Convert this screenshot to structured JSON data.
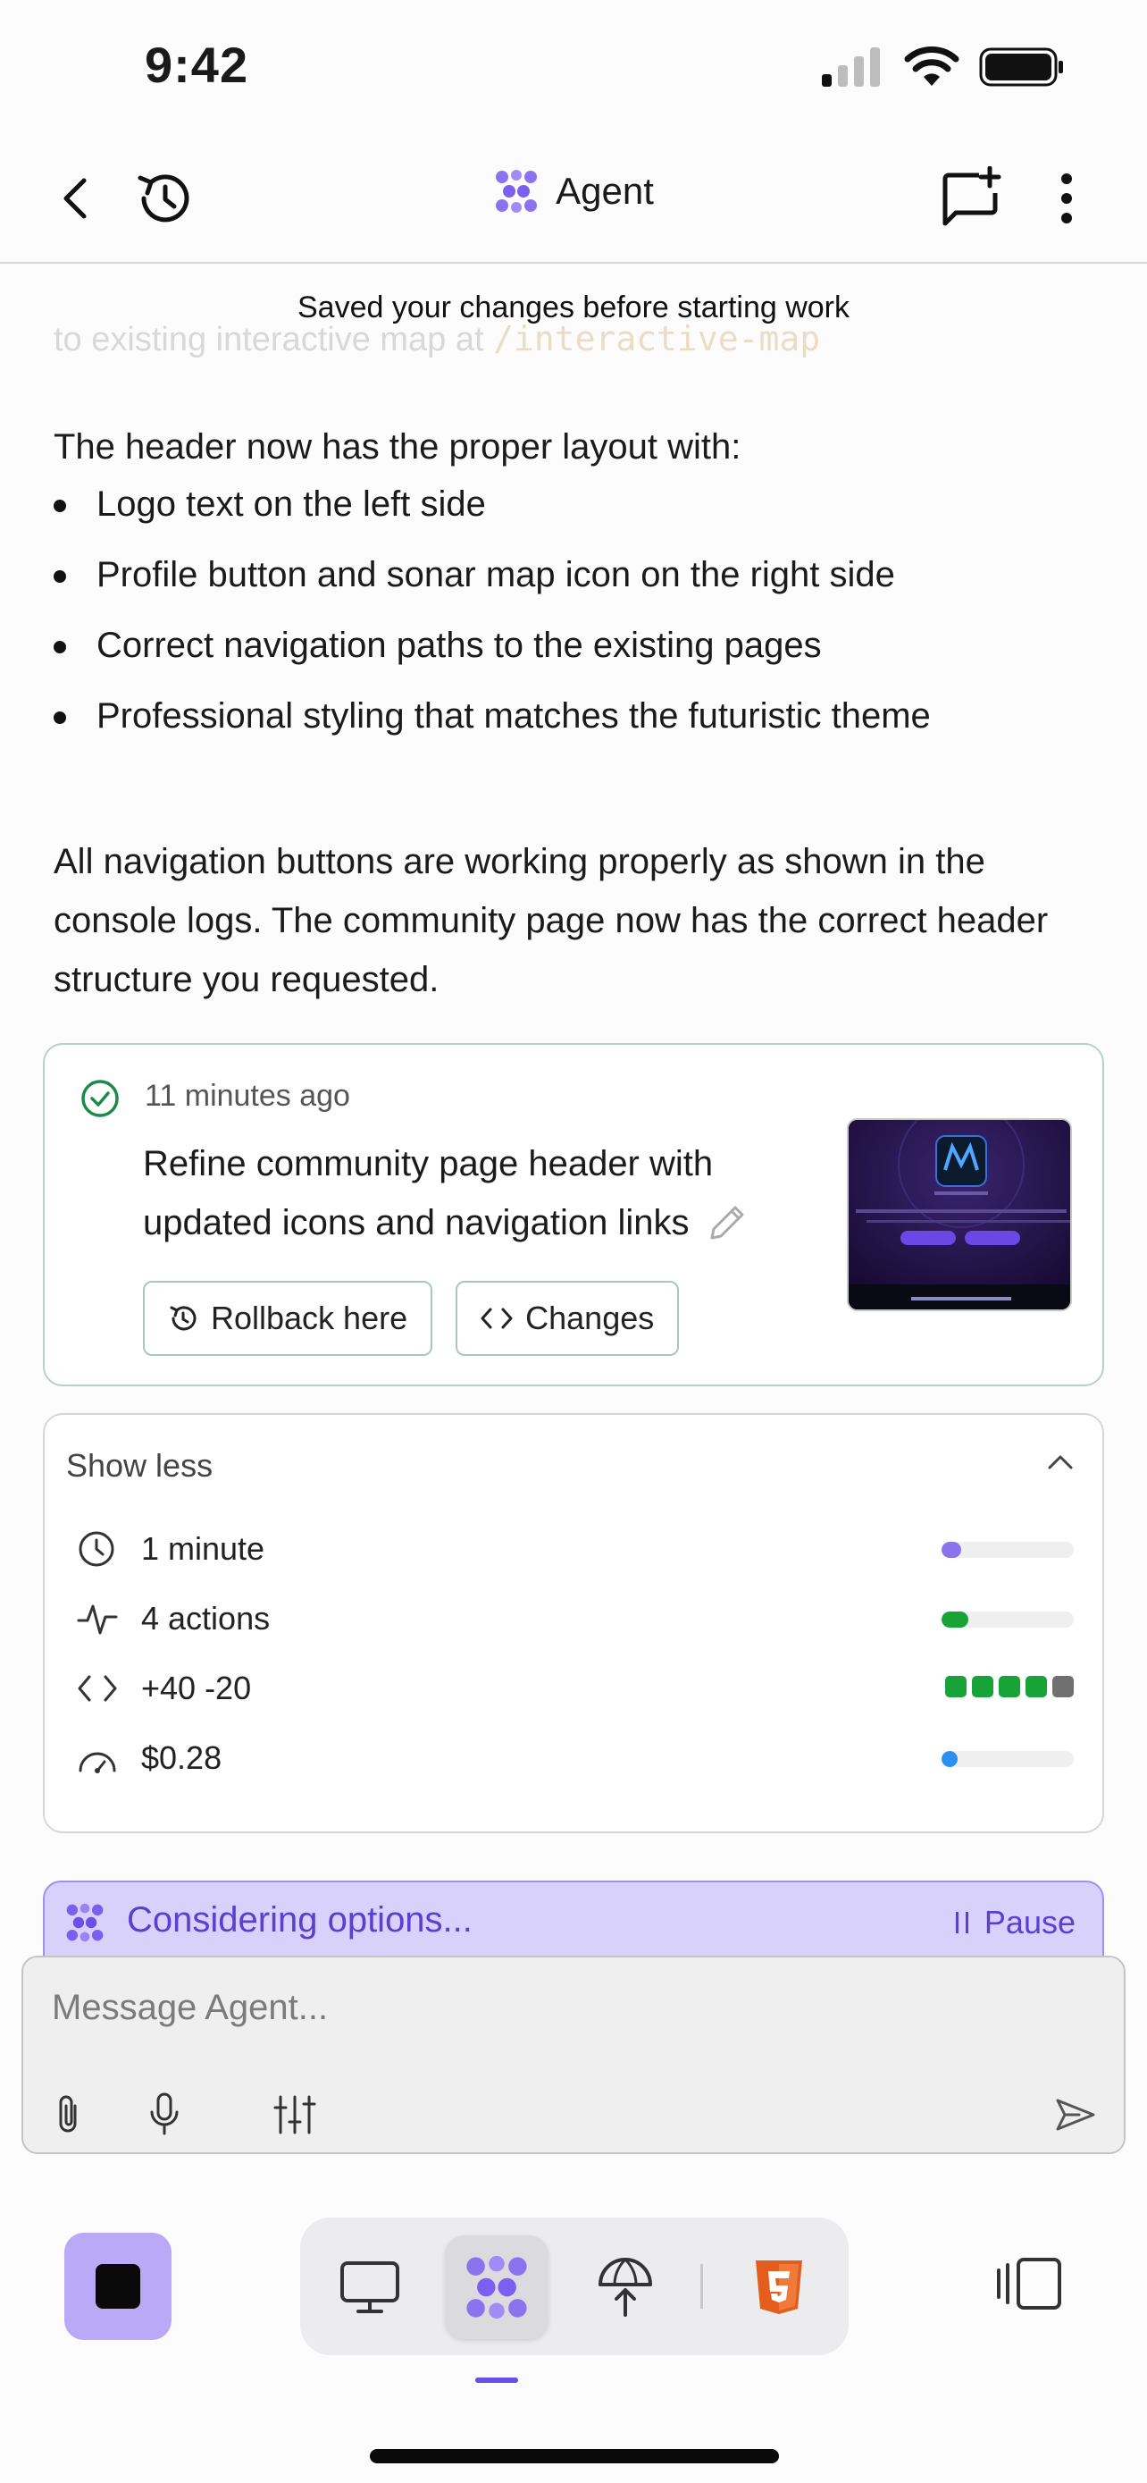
{
  "status_bar": {
    "time": "9:42"
  },
  "header": {
    "title": "Agent"
  },
  "toast": "Saved your changes before starting work",
  "faded_line": {
    "text": "to existing interactive map at ",
    "code": "/interactive-map"
  },
  "intro": "The header now has the proper layout with:",
  "bullets": [
    "Logo text on the left side",
    "Profile button and sonar map icon on the right side",
    "Correct navigation paths to the existing pages",
    "Professional styling that matches the futuristic theme"
  ],
  "summary": "All navigation buttons are working properly as shown in the console logs. The community page now has the correct header structure you requested.",
  "checkpoint": {
    "time_ago": "11 minutes ago",
    "message": "Refine community page header with updated icons and navigation links",
    "rollback_label": "Rollback here",
    "changes_label": "Changes"
  },
  "stats": {
    "toggle_label": "Show less",
    "duration": "1 minute",
    "actions": "4 actions",
    "diff": "+40 -20",
    "cost": "$0.28",
    "duration_fraction": 0.15,
    "actions_fraction": 0.2,
    "cost_fraction": 0.12,
    "colors": {
      "duration": "#8b73f0",
      "actions": "#17a337",
      "cost": "#2b8ff0"
    }
  },
  "considering": {
    "text": "Considering options...",
    "pause_label": "Pause"
  },
  "composer": {
    "placeholder": "Message Agent..."
  }
}
